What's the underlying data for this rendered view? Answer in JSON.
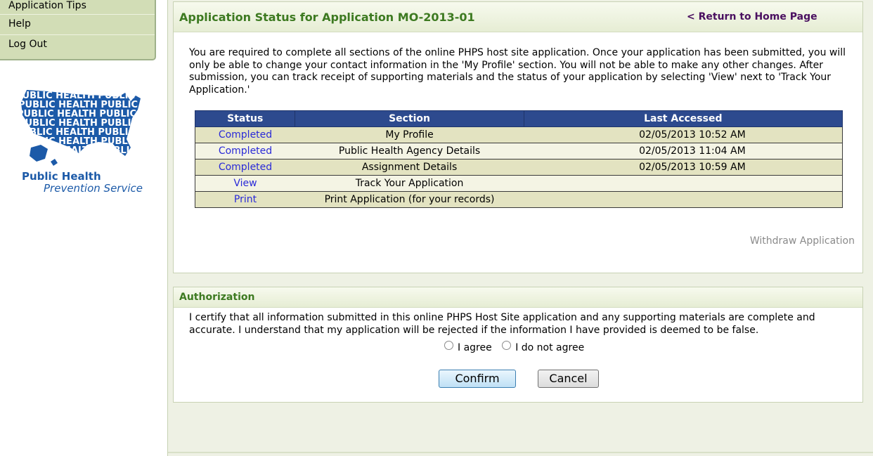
{
  "sidebar": {
    "items": [
      {
        "label": "Application Tips"
      },
      {
        "label": "Help"
      },
      {
        "label": "Log Out"
      }
    ],
    "logo": {
      "line1": "Public Health",
      "line2": "Prevention Service",
      "pattern_text": "PUBLIC HEALTH",
      "color": "#1c5aa8"
    }
  },
  "status_panel": {
    "title": "Application Status for Application MO-2013-01",
    "home_link": "< Return to Home Page",
    "intro": "You are required to complete all sections of the online PHPS host site application. Once your application has been submitted, you will only be able to change your contact information in the 'My Profile' section. You will not be able to make any other changes. After submission, you can track receipt of supporting materials and the status of your application by selecting 'View' next to 'Track Your Application.'",
    "table": {
      "headers": [
        "Status",
        "Section",
        "Last Accessed"
      ],
      "rows": [
        {
          "status": "Completed",
          "section": "My Profile",
          "last": "02/05/2013 10:52 AM"
        },
        {
          "status": "Completed",
          "section": "Public Health Agency Details",
          "last": "02/05/2013 11:04 AM"
        },
        {
          "status": "Completed",
          "section": "Assignment Details",
          "last": "02/05/2013 10:59 AM"
        },
        {
          "status": "View",
          "section": "Track Your Application",
          "last": ""
        },
        {
          "status": "Print",
          "section": "Print Application (for your records)",
          "last": ""
        }
      ]
    },
    "withdraw": "Withdraw Application"
  },
  "authorization": {
    "title": "Authorization",
    "text": "I certify that all information submitted in this online PHPS Host Site application and any supporting materials are complete and accurate.  I understand that my application will be rejected if the information I have provided is deemed to be false.",
    "agree": "I agree",
    "disagree": "I do not agree",
    "confirm": "Confirm",
    "cancel": "Cancel"
  },
  "colors": {
    "title_green": "#3d7a21",
    "header_blue": "#2d4a8e",
    "link_blue": "#2a2ad8",
    "sidebar_bg": "#d2ddb6"
  }
}
